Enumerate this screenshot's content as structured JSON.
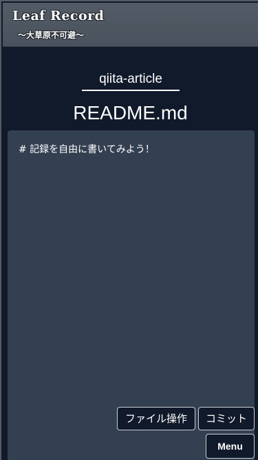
{
  "header": {
    "title": "Leaf Record",
    "subtitle": "〜大草原不可避〜"
  },
  "main": {
    "repository": "qiita-article",
    "filename": "README.md",
    "editor_content": "# 記録を自由に書いてみよう！"
  },
  "toolbar": {
    "file_ops_label": "ファイル操作",
    "commit_label": "コミット",
    "menu_label": "Menu"
  },
  "colors": {
    "background": "#101a2a",
    "header": "#535b66",
    "editor": "#334052",
    "text": "#ffffff"
  }
}
